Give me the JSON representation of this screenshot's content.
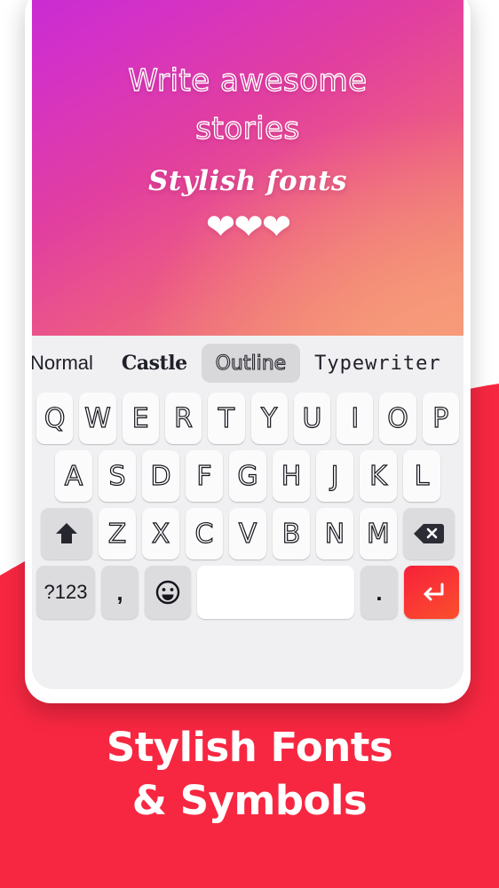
{
  "banner": {
    "headline_line1": "Write awesome",
    "headline_line2": "stories",
    "script_line": "Stylish fonts",
    "hearts": "❤❤❤",
    "gradient_start": "#c72bd4",
    "gradient_end": "#f4a07b"
  },
  "font_strip": {
    "items": [
      {
        "label": "Normal",
        "style": "normal",
        "selected": false
      },
      {
        "label": "Castle",
        "style": "blackletter",
        "selected": false
      },
      {
        "label": "Outline",
        "style": "outline",
        "selected": true
      },
      {
        "label": "Typewriter",
        "style": "monospace",
        "selected": false
      }
    ]
  },
  "keyboard": {
    "row1": [
      "Q",
      "W",
      "E",
      "R",
      "T",
      "Y",
      "U",
      "I",
      "O",
      "P"
    ],
    "row2": [
      "A",
      "S",
      "D",
      "F",
      "G",
      "H",
      "J",
      "K",
      "L"
    ],
    "row3": [
      "Z",
      "X",
      "C",
      "V",
      "B",
      "N",
      "M"
    ],
    "shift_key": "shift-icon",
    "backspace_key": "backspace-icon",
    "symbols_key": "?123",
    "comma_key": ",",
    "emoji_key": "emoji-icon",
    "space_key": "",
    "period_key": ".",
    "enter_key": "enter-icon",
    "enter_color": "#f93535",
    "background": "#f0f0f2"
  },
  "caption": {
    "line1": "Stylish Fonts",
    "line2": "& Symbols",
    "background": "#f72741",
    "text_color": "#ffffff"
  }
}
